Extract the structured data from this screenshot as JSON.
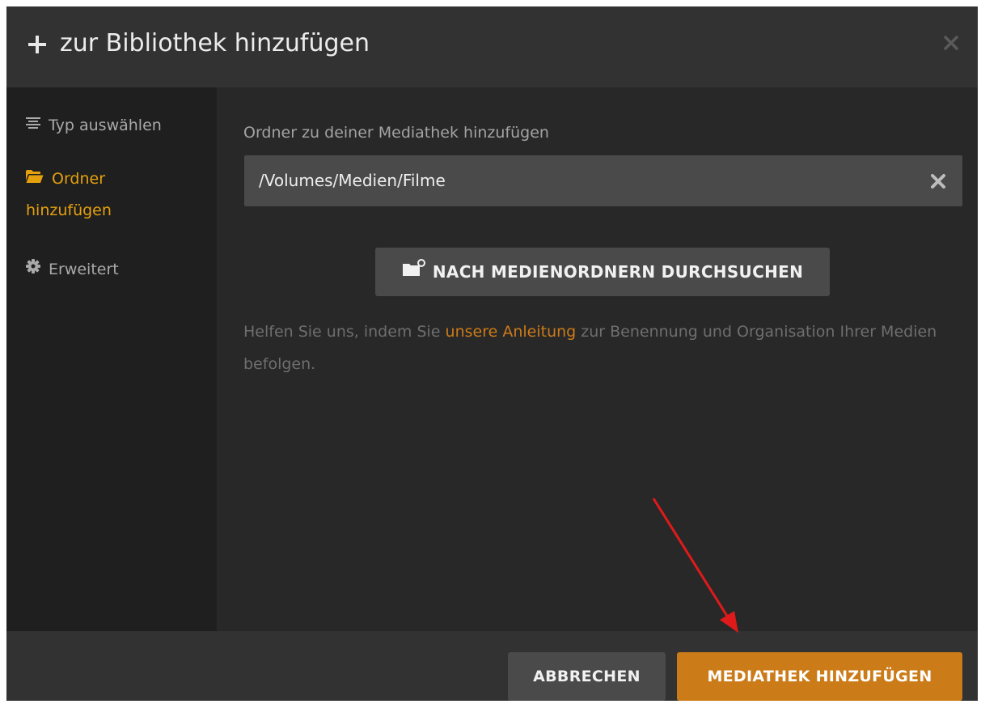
{
  "dialog": {
    "title": "zur Bibliothek hinzufügen",
    "header_icon": "plus-icon",
    "close_icon": "close-icon"
  },
  "sidebar": {
    "items": [
      {
        "label": "Typ auswählen",
        "icon": "list-icon",
        "active": false
      },
      {
        "label": "Ordner hinzufügen",
        "line1": "Ordner",
        "line2": "hinzufügen",
        "icon": "folder-open-icon",
        "active": true
      },
      {
        "label": "Erweitert",
        "icon": "gear-icon",
        "active": false
      }
    ]
  },
  "main": {
    "field_label": "Ordner zu deiner Mediathek hinzufügen",
    "path_value": "/Volumes/Medien/Filme",
    "browse_button_label": "NACH MEDIENORDNERN DURCHSUCHEN",
    "help_text_before": "Helfen Sie uns, indem Sie ",
    "help_link": "unsere Anleitung",
    "help_text_after": " zur Benennung und Organisation Ihrer Medien befolgen."
  },
  "footer": {
    "cancel_label": "ABBRECHEN",
    "add_label": "MEDIATHEK HINZUFÜGEN"
  },
  "colors": {
    "accent": "#cc7b19",
    "active_sidebar": "#e5a00d",
    "annotation_arrow": "#e01a1a"
  }
}
